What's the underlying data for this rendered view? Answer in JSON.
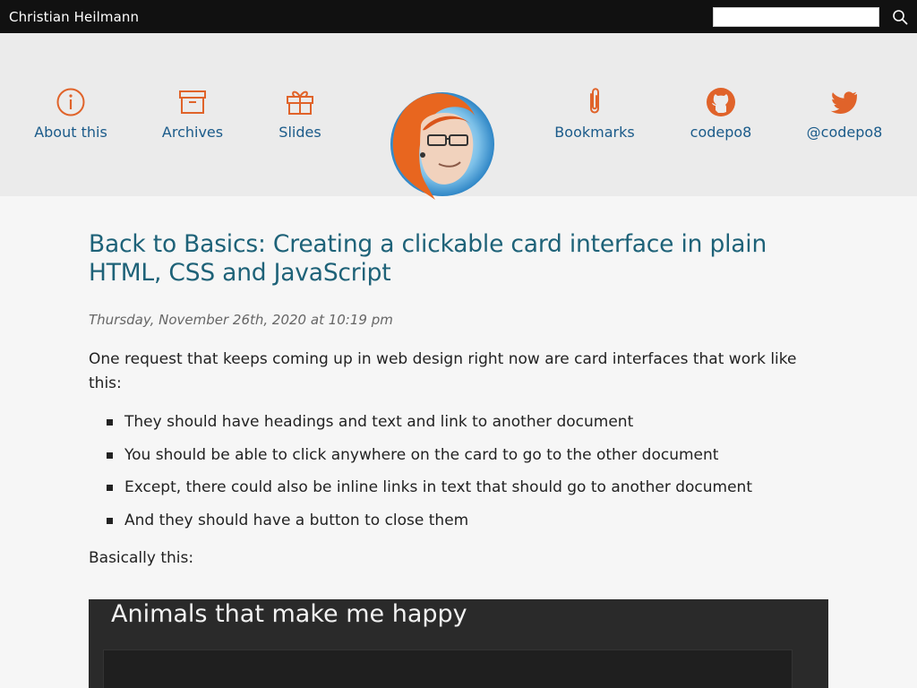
{
  "topbar": {
    "site_title": "Christian Heilmann",
    "search_value": "",
    "search_icon": "search-icon"
  },
  "nav": {
    "left": [
      {
        "label": "About this",
        "icon": "info-icon"
      },
      {
        "label": "Archives",
        "icon": "archive-box-icon"
      },
      {
        "label": "Slides",
        "icon": "gift-icon"
      }
    ],
    "right": [
      {
        "label": "Bookmarks",
        "icon": "paperclip-icon"
      },
      {
        "label": "codepo8",
        "icon": "github-icon"
      },
      {
        "label": "@codepo8",
        "icon": "twitter-icon"
      }
    ],
    "accent_color": "#e0632a",
    "link_color": "#1b5b8a"
  },
  "post": {
    "title": "Back to Basics: Creating a clickable card interface in plain HTML, CSS and JavaScript",
    "date": "Thursday, November 26th, 2020 at 10:19 pm",
    "intro": "One request that keeps coming up in web design right now are card interfaces that work like this:",
    "bullets": [
      "They should have headings and text and link to another document",
      "You should be able to click anywhere on the card to go to the other document",
      "Except, there could also be inline links in text that should go to another document",
      "And they should have a button to close them"
    ],
    "basically": "Basically this:",
    "demo_heading": "Animals that make me happy"
  }
}
